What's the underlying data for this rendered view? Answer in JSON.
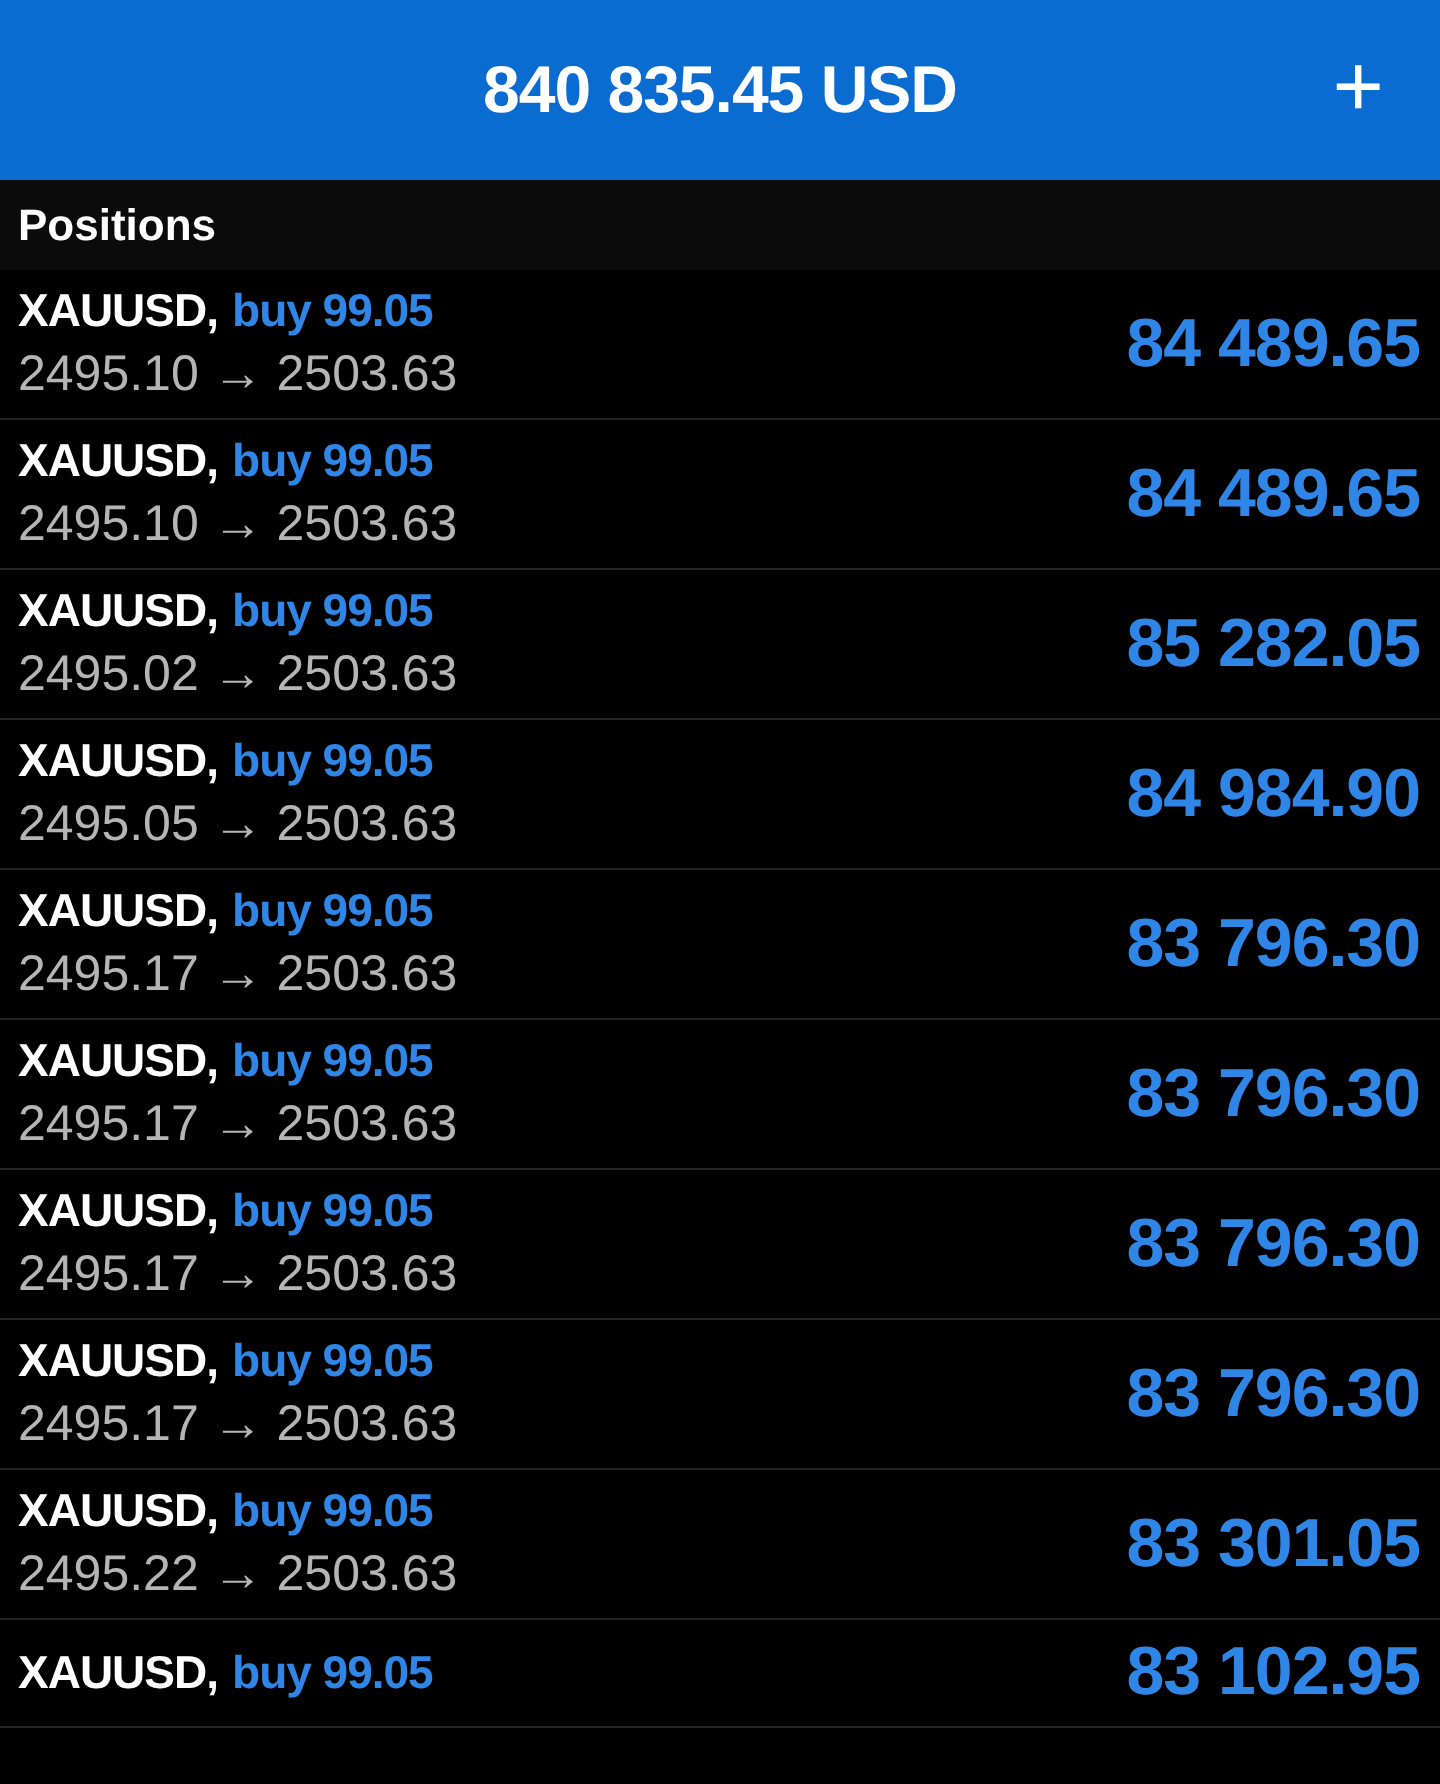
{
  "header": {
    "balance": "840 835.45 USD",
    "add_button": "+"
  },
  "section_title": "Positions",
  "positions": [
    {
      "symbol": "XAUUSD,",
      "side": "buy 99.05",
      "prices": "2495.10 → 2503.63",
      "profit": "84 489.65"
    },
    {
      "symbol": "XAUUSD,",
      "side": "buy 99.05",
      "prices": "2495.10 → 2503.63",
      "profit": "84 489.65"
    },
    {
      "symbol": "XAUUSD,",
      "side": "buy 99.05",
      "prices": "2495.02 → 2503.63",
      "profit": "85 282.05"
    },
    {
      "symbol": "XAUUSD,",
      "side": "buy 99.05",
      "prices": "2495.05 → 2503.63",
      "profit": "84 984.90"
    },
    {
      "symbol": "XAUUSD,",
      "side": "buy 99.05",
      "prices": "2495.17 → 2503.63",
      "profit": "83 796.30"
    },
    {
      "symbol": "XAUUSD,",
      "side": "buy 99.05",
      "prices": "2495.17 → 2503.63",
      "profit": "83 796.30"
    },
    {
      "symbol": "XAUUSD,",
      "side": "buy 99.05",
      "prices": "2495.17 → 2503.63",
      "profit": "83 796.30"
    },
    {
      "symbol": "XAUUSD,",
      "side": "buy 99.05",
      "prices": "2495.17 → 2503.63",
      "profit": "83 796.30"
    },
    {
      "symbol": "XAUUSD,",
      "side": "buy 99.05",
      "prices": "2495.22 → 2503.63",
      "profit": "83 301.05"
    },
    {
      "symbol": "XAUUSD,",
      "side": "buy 99.05",
      "profit": "83 102.95"
    }
  ]
}
